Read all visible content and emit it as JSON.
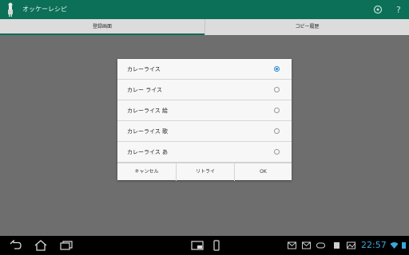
{
  "app": {
    "title": "オッケーレシピ",
    "icon": "chef-icon"
  },
  "actionbar": {
    "icons": [
      "settings-icon",
      "help-icon"
    ],
    "help_glyph": "?"
  },
  "tabs": [
    {
      "label": "登録画面",
      "selected": true
    },
    {
      "label": "コピー履歴",
      "selected": false
    }
  ],
  "dialog": {
    "options": [
      {
        "label": "カレーライス",
        "selected": true
      },
      {
        "label": "カレー ライス",
        "selected": false
      },
      {
        "label": "カレーライス 絵",
        "selected": false
      },
      {
        "label": "カレーライス 歌",
        "selected": false
      },
      {
        "label": "カレーライス あ",
        "selected": false
      }
    ],
    "buttons": {
      "cancel": "キャンセル",
      "retry": "リトライ",
      "ok": "OK"
    }
  },
  "system_bar": {
    "time": "22:57",
    "accent": "#3ba7d9"
  },
  "colors": {
    "actionbar": "#0c6f57",
    "radio_selected": "#2e8fd1"
  }
}
